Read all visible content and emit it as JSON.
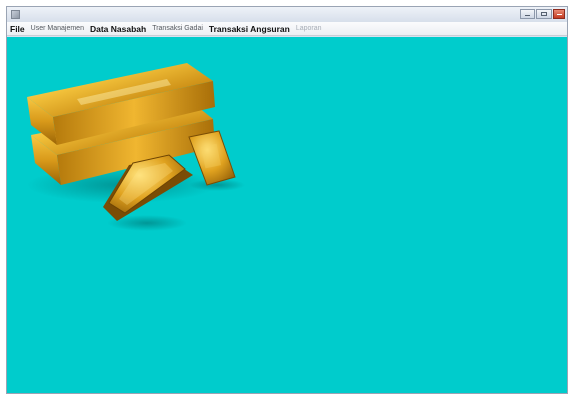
{
  "window": {
    "title": ""
  },
  "menu": {
    "items": [
      {
        "label": "File",
        "style": "bold"
      },
      {
        "label": "User Manajemen",
        "style": "light"
      },
      {
        "label": "Data Nasabah",
        "style": "bold"
      },
      {
        "label": "Transaksi Gadai",
        "style": "light"
      },
      {
        "label": "Transaksi Angsuran",
        "style": "bold"
      },
      {
        "label": "Laporan",
        "style": "disabled"
      }
    ]
  },
  "content": {
    "background_color": "#00cccc",
    "image": "gold-bars"
  }
}
